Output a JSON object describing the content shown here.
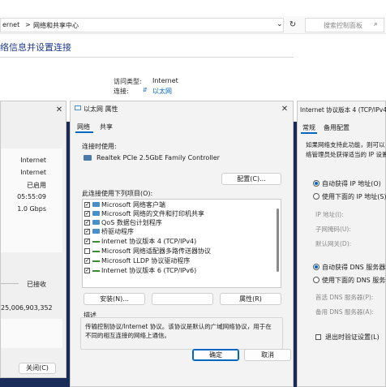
{
  "network_center": {
    "breadcrumb_part1": "ernet",
    "breadcrumb_sep": ">",
    "breadcrumb_part2": "网络和共享中心",
    "breadcrumb_chevron": "⌄",
    "search_placeholder": "搜索控制面板",
    "page_heading": "络信息并设置连接",
    "access_type_label": "访问类型:",
    "access_type_value": "Internet",
    "connection_label": "连接:",
    "connection_value": "以太网"
  },
  "status_window": {
    "rows": [
      "Internet",
      "Internet",
      "已启用",
      "05:55:09",
      "1.0 Gbps"
    ],
    "received_label": "已接收",
    "bytes_value": "25,006,903,352",
    "close_label": "关闭(C)"
  },
  "properties_window": {
    "title": "以太网 属性",
    "tabs": [
      "网络",
      "共享"
    ],
    "connect_using_label": "连接时使用:",
    "adapter_name": "Realtek PCIe 2.5GbE Family Controller",
    "configure_label": "配置(C)...",
    "items_label": "此连接使用下列项目(O):",
    "items": [
      {
        "label": "Microsoft 网络客户端",
        "checked": true
      },
      {
        "label": "Microsoft 网络的文件和打印机共享",
        "checked": true
      },
      {
        "label": "QoS 数据包计划程序",
        "checked": true
      },
      {
        "label": "桥驱动程序",
        "checked": true
      },
      {
        "label": "Internet 协议版本 4 (TCP/IPv4)",
        "checked": true
      },
      {
        "label": "Microsoft 网络适配器多路传送器协议",
        "checked": false
      },
      {
        "label": "Microsoft LLDP 协议驱动程序",
        "checked": true
      },
      {
        "label": "Internet 协议版本 6 (TCP/IPv6)",
        "checked": true
      }
    ],
    "install_label": "安装(N)...",
    "properties_label": "属性(R)",
    "description_label": "描述",
    "description_text": "传输控制协议/Internet 协议。该协议是默认的广域网络协议，用于在不同的相互连接的网络上通信。",
    "ok_label": "确定",
    "cancel_label": "取消"
  },
  "ipv4_window": {
    "title": "Internet 协议版本 4 (TCP/IPv4) 属",
    "tabs": [
      "常规",
      "备用配置"
    ],
    "desc_line1": "如果网络支持此功能，则可以",
    "desc_line2": "络管理员处获得适当的 IP 设置",
    "auto_ip_label": "自动获得 IP 地址(O)",
    "manual_ip_label": "使用下面的 IP 地址(S):",
    "ip_address_label": "IP 地址(I):",
    "subnet_label": "子网掩码(U):",
    "gateway_label": "默认网关(D):",
    "auto_dns_label": "自动获得 DNS 服务器地",
    "manual_dns_label": "使用下面的 DNS 服务器",
    "preferred_dns_label": "首选 DNS 服务器(P):",
    "alternate_dns_label": "备用 DNS 服务器(A):",
    "validate_label": "退出时验证设置(L)"
  },
  "colors": {
    "accent": "#0067c0",
    "desktop": "#1b2a52"
  }
}
